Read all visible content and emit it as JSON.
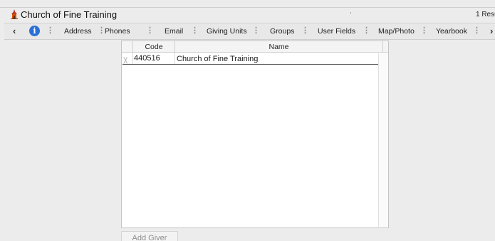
{
  "window": {
    "title": "Church of Fine Training",
    "results_text": "1 Resu"
  },
  "tabbar": {
    "prev_arrow": "‹",
    "next_arrow": "›",
    "dots": "⋮",
    "tabs": [
      {
        "label": "Address"
      },
      {
        "label": "Phones"
      },
      {
        "label": "Email"
      },
      {
        "label": "Giving Units"
      },
      {
        "label": "Groups"
      },
      {
        "label": "User Fields"
      },
      {
        "label": "Map/Photo"
      },
      {
        "label": "Yearbook"
      }
    ]
  },
  "table": {
    "columns": [
      "Code",
      "Name"
    ],
    "rows": [
      {
        "marker": "χ",
        "code": "440516",
        "name": "Church of Fine Training"
      }
    ]
  },
  "actions": {
    "add_giver_label": "Add Giver"
  },
  "colors": {
    "info_icon": "#2a6fd6",
    "church_icon": "#c0392b"
  },
  "icons": {
    "title": "church-icon",
    "info": "info-icon"
  }
}
